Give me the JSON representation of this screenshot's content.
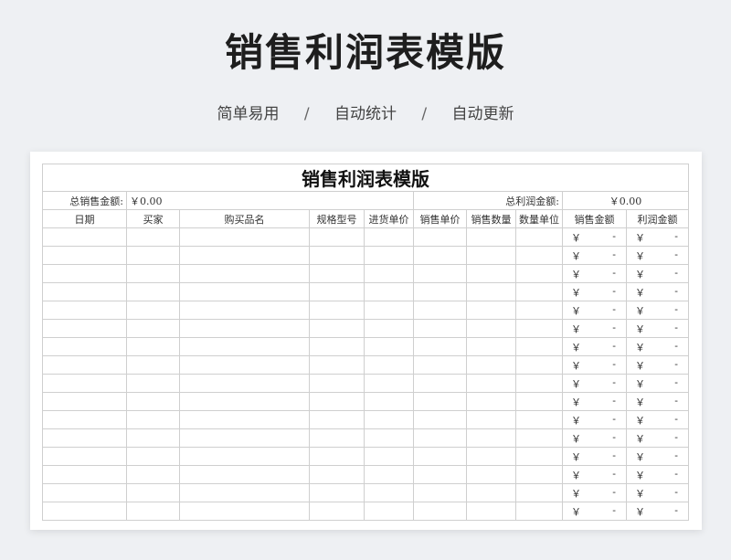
{
  "hero": {
    "title": "销售利润表模版",
    "tagline_1": "简单易用",
    "tagline_2": "自动统计",
    "tagline_3": "自动更新",
    "separator": "/"
  },
  "sheet": {
    "title": "销售利润表模版",
    "total_sales_label": "总销售金额:",
    "total_sales_value": "￥0.00",
    "total_profit_label": "总利润金额:",
    "total_profit_value": "￥0.00",
    "columns": [
      "日期",
      "买家",
      "购买品名",
      "规格型号",
      "进货单价",
      "销售单价",
      "销售数量",
      "数量单位",
      "销售金额",
      "利润金额"
    ],
    "currency_symbol": "￥",
    "empty_value": "-",
    "row_count": 16
  },
  "colors": {
    "background": "#eef0f3",
    "grid_line": "#cfcfcf"
  }
}
